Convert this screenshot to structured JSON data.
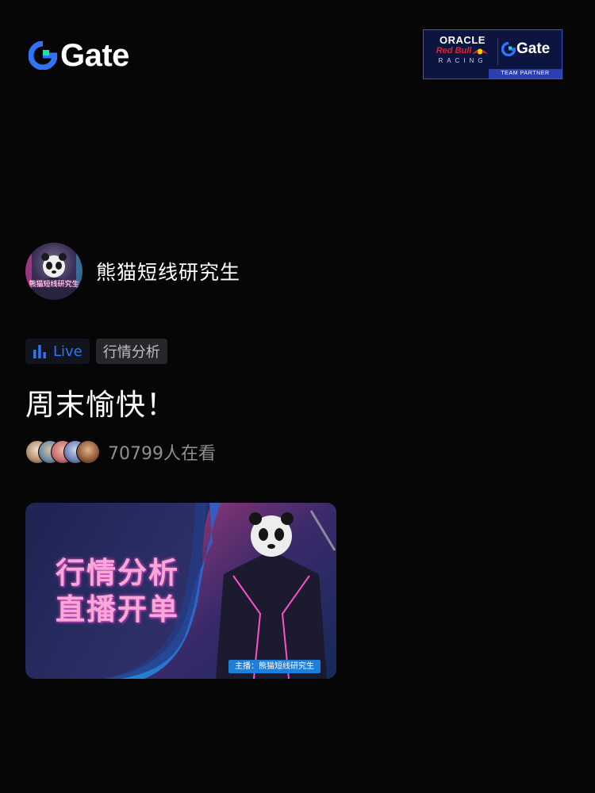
{
  "header": {
    "logo_text": "Gate",
    "partner": {
      "oracle": "ORACLE",
      "redbull": "Red Bull",
      "racing": "RACING",
      "gate_text": "Gate",
      "footer": "TEAM PARTNER"
    }
  },
  "streamer": {
    "avatar_caption": "熊猫短线研究生",
    "name": "熊猫短线研究生"
  },
  "tags": {
    "live": "Live",
    "category": "行情分析"
  },
  "stream": {
    "title": "周末愉快！",
    "viewer_count": "70799人在看"
  },
  "thumbnail": {
    "line1": "行情分析",
    "line2": "直播开单",
    "host_label": "主播：熊猫短线研究生"
  },
  "colors": {
    "background": "#060606",
    "brand_blue": "#2f74f5",
    "brand_green": "#17e6a1",
    "thumb_pink": "#f6a9d8"
  }
}
